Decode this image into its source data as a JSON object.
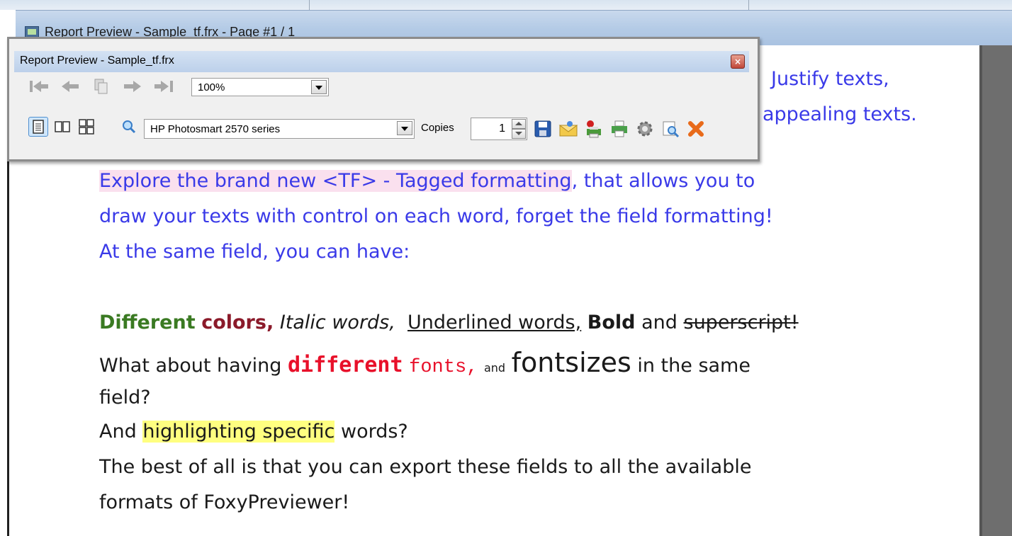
{
  "outer_window": {
    "title": "Report Preview - Sample_tf.frx - Page #1 / 1"
  },
  "toolbar": {
    "title": "Report Preview - Sample_tf.frx",
    "close_glyph": "×",
    "zoom_value": "100%",
    "printer_value": "HP Photosmart 2570 series",
    "copies_label": "Copies",
    "copies_value": "1"
  },
  "report": {
    "top_right_line1": "Justify texts,",
    "top_right_line2": "appealing texts.",
    "para1_highlighted": "Explore the brand new <TF> - Tagged formatting",
    "para1_rest": ", that allows you to",
    "para1_line2": "draw your texts with control on each word, forget the field formatting!",
    "para1_line3": "At the same field, you can have:",
    "styles": {
      "green": "Different",
      "maroon": "colors,",
      "italic": "Italic words,",
      "underlined": "Underlined words,",
      "bold": "Bold",
      "and": "and",
      "strike": "superscript!"
    },
    "fonts_line": {
      "prefix": "What about having",
      "mono_bold": "different",
      "mono_light": "fonts,",
      "small": "and",
      "big": "fontsizes",
      "suffix": "in the same"
    },
    "fonts_line2": "field?",
    "highlight_prefix": "And",
    "highlight_word": "highlighting specific",
    "highlight_suffix": "words?",
    "export_line1": "The best of all is that you can export these fields to all the available",
    "export_line2": "formats of FoxyPreviewer!"
  },
  "icons": [
    "first-page-icon",
    "previous-page-icon",
    "go-to-page-icon",
    "next-page-icon",
    "last-page-icon",
    "single-page-icon",
    "two-pages-icon",
    "four-pages-icon",
    "search-icon",
    "save-icon",
    "email-icon",
    "print-setup-icon",
    "print-icon",
    "settings-icon",
    "find-icon",
    "close-x-icon"
  ],
  "colors": {
    "report_blue": "#3a3ae8",
    "green_word": "#3a7a22",
    "maroon_word": "#8b1a2a",
    "font_red": "#e8102a",
    "tf_highlight": "#fae0ee",
    "yellow_highlight": "#ffff80"
  }
}
